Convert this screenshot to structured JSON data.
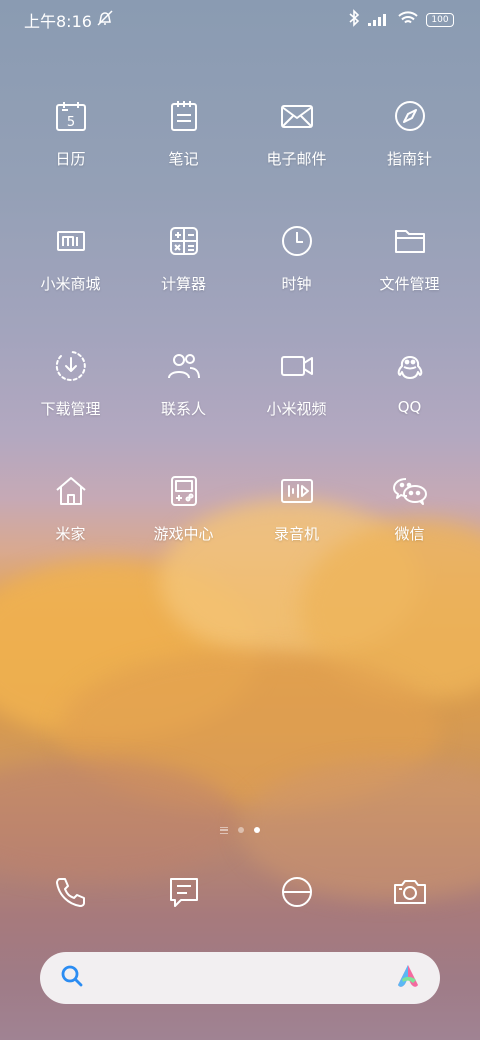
{
  "status_bar": {
    "time": "上午8:16",
    "battery": "100"
  },
  "apps": [
    {
      "label": "日历",
      "icon": "calendar-icon",
      "day": "5"
    },
    {
      "label": "笔记",
      "icon": "notes-icon"
    },
    {
      "label": "电子邮件",
      "icon": "email-icon"
    },
    {
      "label": "指南针",
      "icon": "compass-icon"
    },
    {
      "label": "小米商城",
      "icon": "mi-store-icon"
    },
    {
      "label": "计算器",
      "icon": "calculator-icon"
    },
    {
      "label": "时钟",
      "icon": "clock-icon"
    },
    {
      "label": "文件管理",
      "icon": "folder-icon"
    },
    {
      "label": "下载管理",
      "icon": "download-icon"
    },
    {
      "label": "联系人",
      "icon": "contacts-icon"
    },
    {
      "label": "小米视频",
      "icon": "video-icon"
    },
    {
      "label": "QQ",
      "icon": "qq-icon"
    },
    {
      "label": "米家",
      "icon": "home-icon"
    },
    {
      "label": "游戏中心",
      "icon": "game-center-icon"
    },
    {
      "label": "录音机",
      "icon": "recorder-icon"
    },
    {
      "label": "微信",
      "icon": "wechat-icon"
    }
  ],
  "page_indicator": {
    "pages": 3,
    "active": 2
  },
  "dock": [
    {
      "icon": "phone-icon"
    },
    {
      "icon": "messages-icon"
    },
    {
      "icon": "browser-icon"
    },
    {
      "icon": "camera-icon"
    }
  ],
  "search": {
    "placeholder": ""
  },
  "colors": {
    "icon_stroke": "#ffffff",
    "search_icon": "#2b8cf2"
  }
}
